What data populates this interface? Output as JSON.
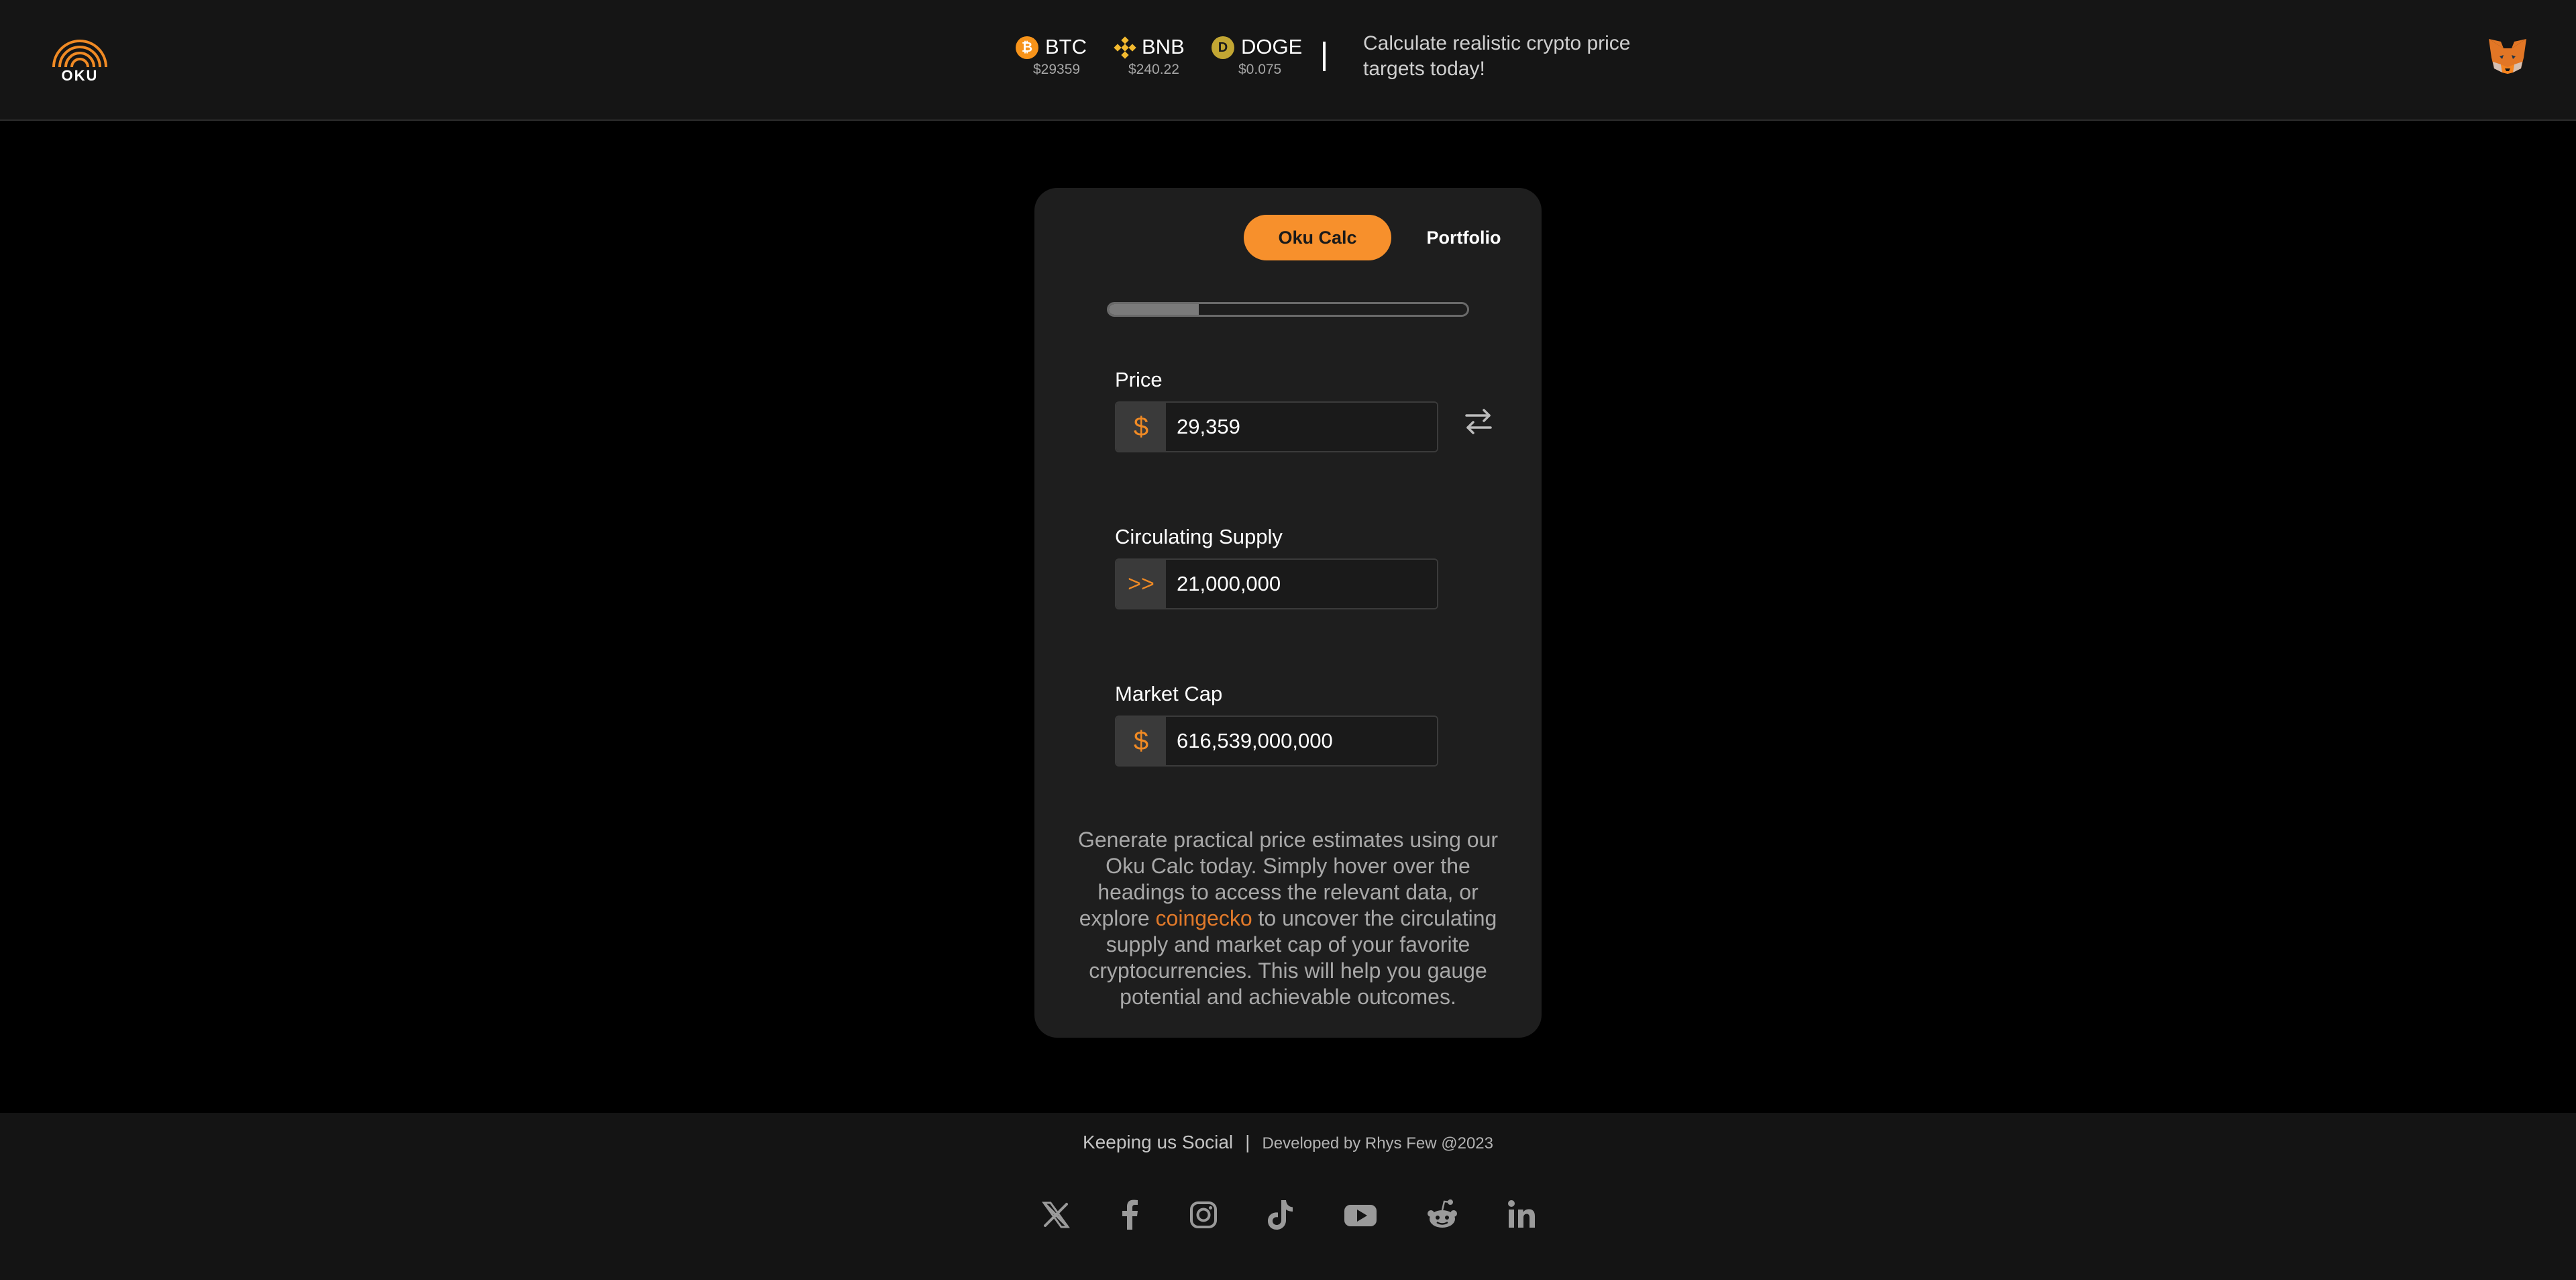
{
  "header": {
    "logo_text": "OKU",
    "tickers": [
      {
        "symbol": "BTC",
        "price": "$29359",
        "icon": "bitcoin-icon",
        "icon_glyph": "₿",
        "color": "#f7931a"
      },
      {
        "symbol": "BNB",
        "price": "$240.22",
        "icon": "bnb-icon",
        "color": "#f3ba2f"
      },
      {
        "symbol": "DOGE",
        "price": "$0.075",
        "icon": "doge-icon",
        "icon_glyph": "D",
        "color": "#c2a633"
      }
    ],
    "tagline": "Calculate realistic crypto price targets today!",
    "wallet_icon": "metamask-fox-icon"
  },
  "card": {
    "tabs": [
      {
        "label": "Oku Calc",
        "active": true
      },
      {
        "label": "Portfolio",
        "active": false
      }
    ],
    "progress_fraction": 0.25,
    "fields": {
      "price": {
        "label": "Price",
        "prefix": "$",
        "value": "29,359"
      },
      "supply": {
        "label": "Circulating Supply",
        "prefix": ">>",
        "value": "21,000,000"
      },
      "market_cap": {
        "label": "Market Cap",
        "prefix": "$",
        "value": "616,539,000,000"
      }
    },
    "swap_icon": "swap-arrows-icon",
    "description": {
      "before": "Generate practical price estimates using our Oku Calc today. Simply hover over the headings to access the relevant data, or explore ",
      "link": "coingecko",
      "after": " to uncover the circulating supply and market cap of your favorite cryptocurrencies. This will help you gauge potential and achievable outcomes."
    }
  },
  "footer": {
    "social_label": "Keeping us Social",
    "separator": "|",
    "developer": "Developed by Rhys Few @2023",
    "social_icons": [
      "x-icon",
      "facebook-icon",
      "instagram-icon",
      "tiktok-icon",
      "youtube-icon",
      "reddit-icon",
      "linkedin-icon"
    ]
  },
  "colors": {
    "accent": "#f7902c",
    "background": "#000000",
    "card": "#1e1e1e",
    "header": "#151515"
  }
}
